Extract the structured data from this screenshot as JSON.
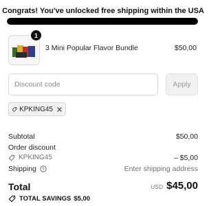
{
  "banner": {
    "text": "Congrats! You've unlocked free shipping within the USA"
  },
  "shipping_progress": {
    "fraction": 1.0
  },
  "cart": {
    "items": [
      {
        "quantity": "1",
        "name": "3 Mini Popular Flavor Bundle",
        "price": "$50,00",
        "icon": "product-image"
      }
    ]
  },
  "discount": {
    "placeholder": "Discount code",
    "value": "",
    "apply_label": "Apply",
    "applied_code": "KPKING45"
  },
  "summary": {
    "subtotal_label": "Subtotal",
    "subtotal_value": "$50,00",
    "order_discount_label": "Order discount",
    "order_discount_code": "KPKING45",
    "order_discount_value": "– $5,00",
    "shipping_label": "Shipping",
    "shipping_value": "Enter shipping address",
    "total_label": "Total",
    "currency": "USD",
    "total_value": "$45,00",
    "savings_label": "TOTAL SAVINGS",
    "savings_value": "$5,00"
  },
  "colors": {
    "progress_fill": "#000000",
    "progress_track": "#e6e6e6",
    "chip_bg": "#f2f2f2"
  },
  "icons": [
    "tag-icon",
    "close-icon",
    "info-icon"
  ]
}
